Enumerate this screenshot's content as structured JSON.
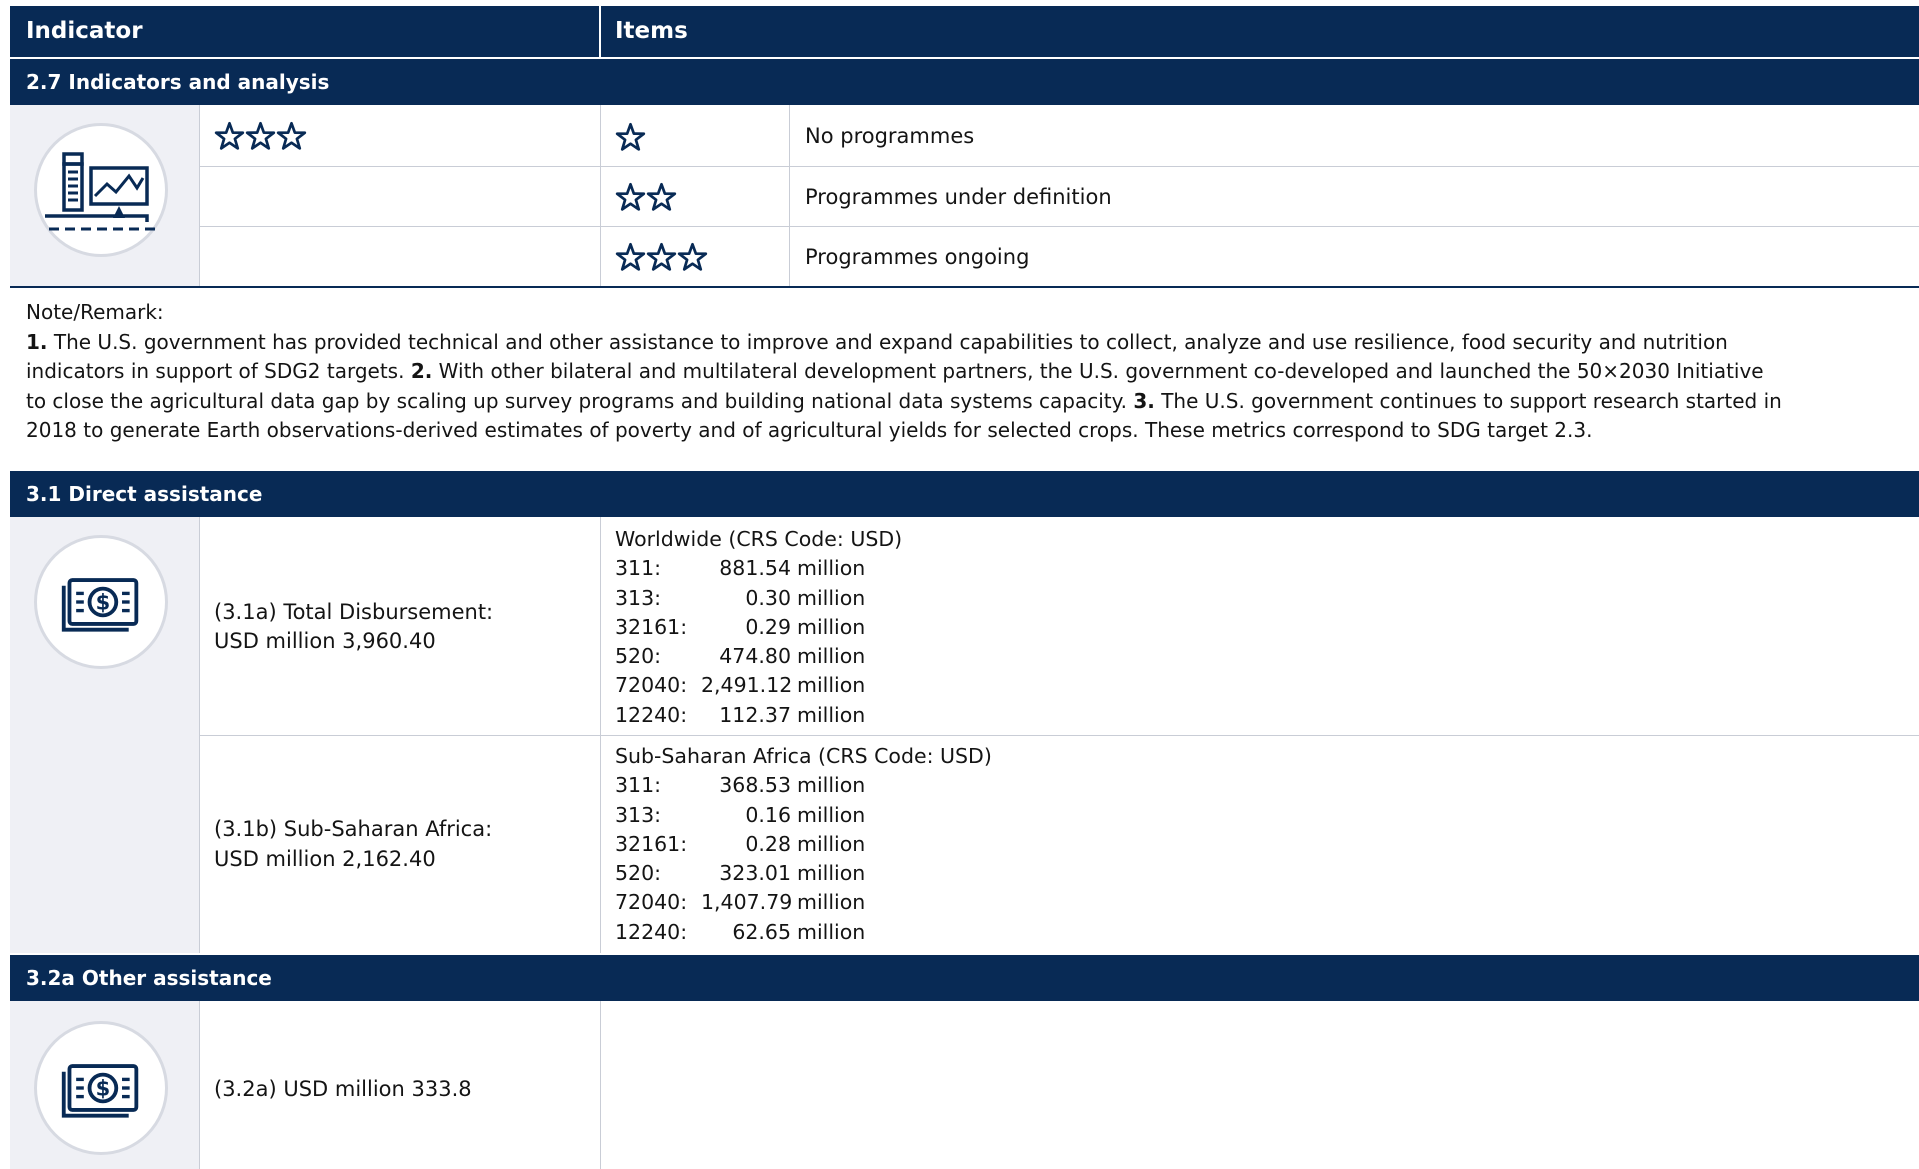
{
  "header": {
    "col_indicator": "Indicator",
    "col_items": "Items"
  },
  "section_27": {
    "title": "2.7  Indicators and analysis",
    "icon": "computer-analytics-icon",
    "rating_stars": 3,
    "legend": [
      {
        "stars": 1,
        "label": "No programmes"
      },
      {
        "stars": 2,
        "label": "Programmes under definition"
      },
      {
        "stars": 3,
        "label": "Programmes ongoing"
      }
    ]
  },
  "note": {
    "label": "Note/Remark:",
    "items": [
      {
        "num": "1.",
        "text": " The U.S. government has provided technical and other assistance to improve and expand capabilities to collect, analyze and use resilience, food security and nutrition indicators in support of SDG2 targets. "
      },
      {
        "num": "2.",
        "text": " With other bilateral and multilateral development partners, the U.S. government co-developed and launched the 50×2030 Initiative to close the agricultural data gap by scaling up survey programs and building national data systems capacity. "
      },
      {
        "num": "3.",
        "text": " The U.S. government continues to support research started in 2018 to generate Earth observations-derived estimates of poverty and of agricultural yields for selected crops. These metrics correspond to SDG target 2.3."
      }
    ]
  },
  "section_31": {
    "title": "3.1  Direct assistance",
    "icon": "money-bill-icon",
    "a": {
      "label_line1": "(3.1a) Total Disbursement:",
      "label_line2": "USD million 3,960.40",
      "crs_title": "Worldwide (CRS Code: USD)",
      "rows": [
        {
          "code": "311:",
          "amount": "881.54",
          "unit": "million"
        },
        {
          "code": "313:",
          "amount": "0.30",
          "unit": "million"
        },
        {
          "code": "32161:",
          "amount": "0.29",
          "unit": "million"
        },
        {
          "code": "520:",
          "amount": "474.80",
          "unit": "million"
        },
        {
          "code": "72040:",
          "amount": "2,491.12",
          "unit": "million"
        },
        {
          "code": "12240:",
          "amount": "112.37",
          "unit": "million"
        }
      ]
    },
    "b": {
      "label_line1": "(3.1b) Sub-Saharan Africa:",
      "label_line2": "USD million 2,162.40",
      "crs_title": "Sub-Saharan Africa (CRS Code: USD)",
      "rows": [
        {
          "code": "311:",
          "amount": "368.53",
          "unit": "million"
        },
        {
          "code": "313:",
          "amount": "0.16",
          "unit": "million"
        },
        {
          "code": "32161:",
          "amount": "0.28",
          "unit": "million"
        },
        {
          "code": "520:",
          "amount": "323.01",
          "unit": "million"
        },
        {
          "code": "72040:",
          "amount": "1,407.79",
          "unit": "million"
        },
        {
          "code": "12240:",
          "amount": "62.65",
          "unit": "million"
        }
      ]
    }
  },
  "section_32a": {
    "title": "3.2a  Other assistance",
    "icon": "money-bill-icon",
    "label": "(3.2a) USD million 333.8"
  },
  "colors": {
    "navy": "#082a55",
    "panel_gray": "#eff0f5",
    "rule": "#c9cdd6"
  }
}
